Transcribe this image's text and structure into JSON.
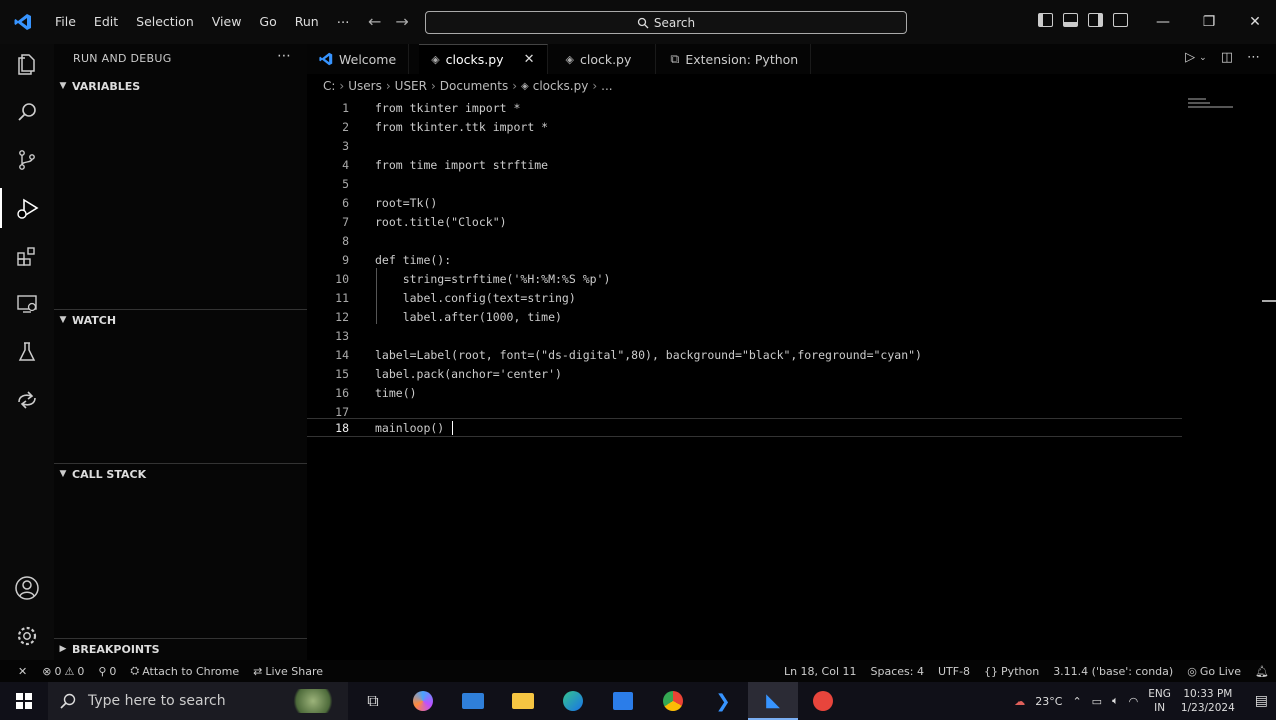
{
  "titlebar": {
    "menu": [
      "File",
      "Edit",
      "Selection",
      "View",
      "Go",
      "Run",
      "⋯"
    ],
    "search_label": "Search"
  },
  "sidebar": {
    "title": "RUN AND DEBUG",
    "more": "⋯",
    "sections": {
      "variables": "VARIABLES",
      "watch": "WATCH",
      "call_stack": "CALL STACK",
      "breakpoints": "BREAKPOINTS"
    }
  },
  "tabs": [
    {
      "label": "Welcome"
    },
    {
      "label": "clocks.py"
    },
    {
      "label": "clock.py"
    },
    {
      "label": "Extension: Python"
    }
  ],
  "breadcrumb": [
    "C:",
    "Users",
    "USER",
    "Documents",
    "clocks.py",
    "..."
  ],
  "code_lines": [
    {
      "n": "1",
      "text": "from tkinter import *"
    },
    {
      "n": "2",
      "text": "from tkinter.ttk import *"
    },
    {
      "n": "3",
      "text": ""
    },
    {
      "n": "4",
      "text": "from time import strftime"
    },
    {
      "n": "5",
      "text": ""
    },
    {
      "n": "6",
      "text": "root=Tk()"
    },
    {
      "n": "7",
      "text": "root.title(\"Clock\")"
    },
    {
      "n": "8",
      "text": ""
    },
    {
      "n": "9",
      "text": "def time():"
    },
    {
      "n": "10",
      "text": "    string=strftime('%H:%M:%S %p')"
    },
    {
      "n": "11",
      "text": "    label.config(text=string)"
    },
    {
      "n": "12",
      "text": "    label.after(1000, time)"
    },
    {
      "n": "13",
      "text": ""
    },
    {
      "n": "14",
      "text": "label=Label(root, font=(\"ds-digital\",80), background=\"black\",foreground=\"cyan\")"
    },
    {
      "n": "15",
      "text": "label.pack(anchor='center')"
    },
    {
      "n": "16",
      "text": "time()"
    },
    {
      "n": "17",
      "text": ""
    },
    {
      "n": "18",
      "text": "mainloop()"
    }
  ],
  "statusbar": {
    "remote": "✕",
    "errors": "0",
    "warnings": "0",
    "ports": "0",
    "attach": "Attach to Chrome",
    "live_share": "Live Share",
    "position": "Ln 18, Col 11",
    "spaces": "Spaces: 4",
    "encoding": "UTF-8",
    "braces": "{}",
    "language": "Python",
    "interpreter": "3.11.4 ('base': conda)",
    "go_live": "Go Live"
  },
  "taskbar": {
    "search_placeholder": "Type here to search",
    "temperature": "23°C",
    "lang_top": "ENG",
    "lang_bottom": "IN",
    "time": "10:33 PM",
    "date": "1/23/2024"
  },
  "colors": {
    "accent": "#3794ff",
    "keyword": "#c586c0",
    "string": "#ce9178"
  }
}
